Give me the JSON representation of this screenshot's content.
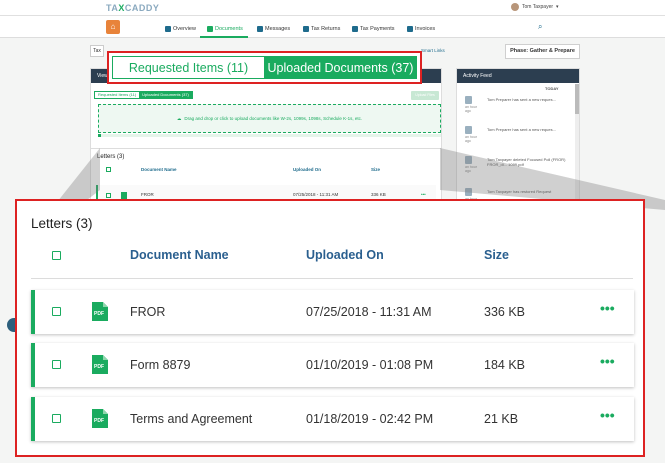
{
  "app": {
    "logo": "TAXCADDY",
    "user_name": "Tom Taxpayer",
    "nav": [
      {
        "label": "Overview"
      },
      {
        "label": "Documents"
      },
      {
        "label": "Messages"
      },
      {
        "label": "Tax Returns"
      },
      {
        "label": "Tax Payments"
      },
      {
        "label": "Invoices"
      }
    ],
    "tax_chip": "Tax",
    "smart_links": "Smart Links",
    "phase": "Phase: Gather & Prepare",
    "view_title": "View",
    "mini_tabs": {
      "requested": "Requested Items (11)",
      "uploaded": "Uploaded Documents (37)"
    },
    "upload_button": "Upload Files",
    "dropzone_text": "Drag and drop or click to upload documents like W-2s, 1099s, 1098s, Schedule K-1s, etc.",
    "upload_progress": 0.01,
    "bg_letters": {
      "title": "Letters (3)",
      "headers": [
        "Document Name",
        "Uploaded On",
        "Size"
      ],
      "row": {
        "name": "FROR",
        "date": "07/25/2018 - 11:31 AM",
        "size": "336 KB"
      }
    },
    "activity": {
      "title": "Activity Feed",
      "today": "TODAY",
      "items": [
        {
          "time": "an hour ago",
          "text": "Tom Preparer has sent a new reques..."
        },
        {
          "time": "an hour ago",
          "text": "Tom Preparer has sent a new reques..."
        },
        {
          "time": "an hour ago",
          "text": "Tom Taxpayer deleted Focused Poll (FROR) FROR_dl... 1099.pdf"
        },
        {
          "time": "an hour ago",
          "text": "Tom Taxpayer has restored Request"
        }
      ]
    }
  },
  "tabs": {
    "requested": "Requested Items (11)",
    "uploaded": "Uploaded Documents (37)"
  },
  "letters": {
    "title": "Letters (3)",
    "headers": {
      "name": "Document Name",
      "uploaded_on": "Uploaded On",
      "size": "Size"
    },
    "rows": [
      {
        "name": "FROR",
        "uploaded_on": "07/25/2018 - 11:31 AM",
        "size": "336 KB",
        "icon": "pdf-icon"
      },
      {
        "name": "Form 8879",
        "uploaded_on": "01/10/2019 - 01:08 PM",
        "size": "184 KB",
        "icon": "pdf-icon"
      },
      {
        "name": "Terms and Agreement",
        "uploaded_on": "01/18/2019 - 02:42 PM",
        "size": "21 KB",
        "icon": "pdf-icon"
      }
    ],
    "row_menu_glyph": "•••"
  },
  "colors": {
    "accent": "#1aab5f",
    "header_blue": "#2a5f8f",
    "callout": "#dd2222",
    "nav_dark": "#2c3e50"
  }
}
